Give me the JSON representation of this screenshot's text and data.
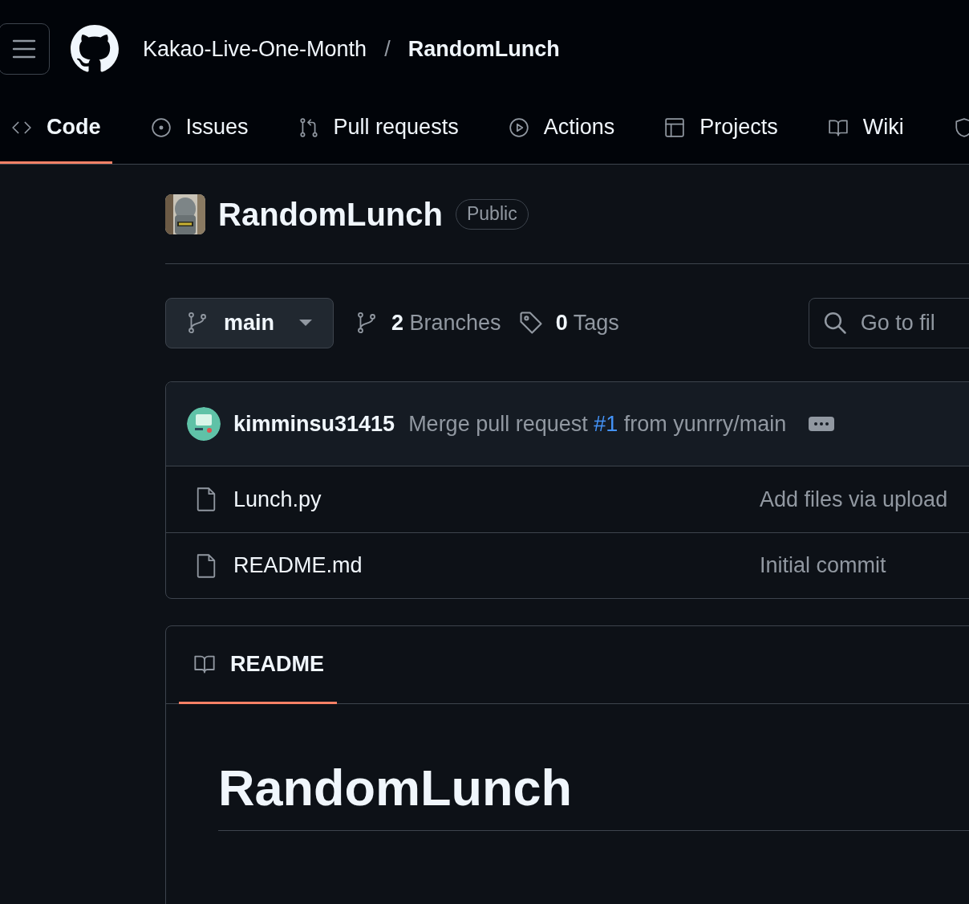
{
  "header": {
    "owner": "Kakao-Live-One-Month",
    "separator": "/",
    "repo": "RandomLunch"
  },
  "tabs": [
    {
      "label": "Code",
      "selected": true
    },
    {
      "label": "Issues",
      "selected": false
    },
    {
      "label": "Pull requests",
      "selected": false
    },
    {
      "label": "Actions",
      "selected": false
    },
    {
      "label": "Projects",
      "selected": false
    },
    {
      "label": "Wiki",
      "selected": false
    },
    {
      "selected": false
    }
  ],
  "repo": {
    "name": "RandomLunch",
    "visibility": "Public"
  },
  "branch_bar": {
    "branch": "main",
    "branches_count": "2",
    "branches_label": "Branches",
    "tags_count": "0",
    "tags_label": "Tags",
    "file_search_placeholder": "Go to fil"
  },
  "latest_commit": {
    "author": "kimminsu31415",
    "message_before": "Merge pull request",
    "pr_link": "#1",
    "message_after": "from yunrry/main"
  },
  "files": [
    {
      "name": "Lunch.py",
      "commit_message": "Add files via upload"
    },
    {
      "name": "README.md",
      "commit_message": "Initial commit"
    }
  ],
  "readme": {
    "tab": "README",
    "selected": true,
    "heading": "RandomLunch"
  }
}
